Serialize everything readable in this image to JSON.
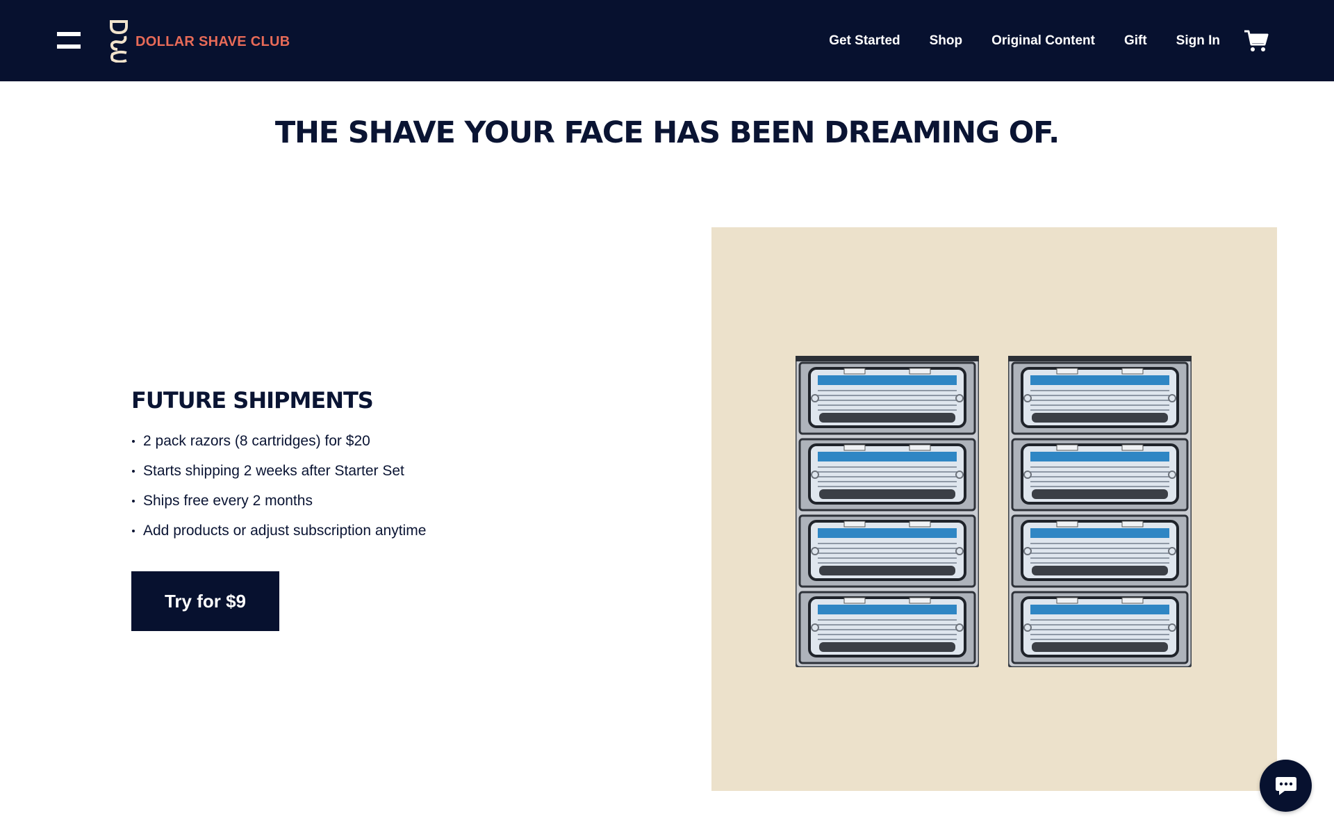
{
  "header": {
    "logo_mark": "DSC",
    "logo_text": "DOLLAR SHAVE CLUB",
    "nav": [
      {
        "label": "Get Started"
      },
      {
        "label": "Shop"
      },
      {
        "label": "Original Content"
      },
      {
        "label": "Gift"
      },
      {
        "label": "Sign In"
      }
    ],
    "icons": {
      "menu": "hamburger-menu-icon",
      "cart": "cart-icon"
    }
  },
  "main": {
    "headline": "THE SHAVE YOUR FACE HAS BEEN DREAMING OF.",
    "section_title": "FUTURE SHIPMENTS",
    "bullets": [
      "2 pack razors (8 cartridges) for $20",
      "Starts shipping 2 weeks after Starter Set",
      "Ships free every 2 months",
      "Add products or adjust subscription anytime"
    ],
    "cta_label": "Try for $9"
  },
  "product_image": {
    "pack_count": 2,
    "cartridges_per_pack": 4
  },
  "chat": {
    "icon": "chat-bubble-icon"
  },
  "colors": {
    "navy": "#07112f",
    "logo_coral": "#e86b58",
    "panel_beige": "#ece1cb",
    "blade_blue": "#2f86c4"
  }
}
